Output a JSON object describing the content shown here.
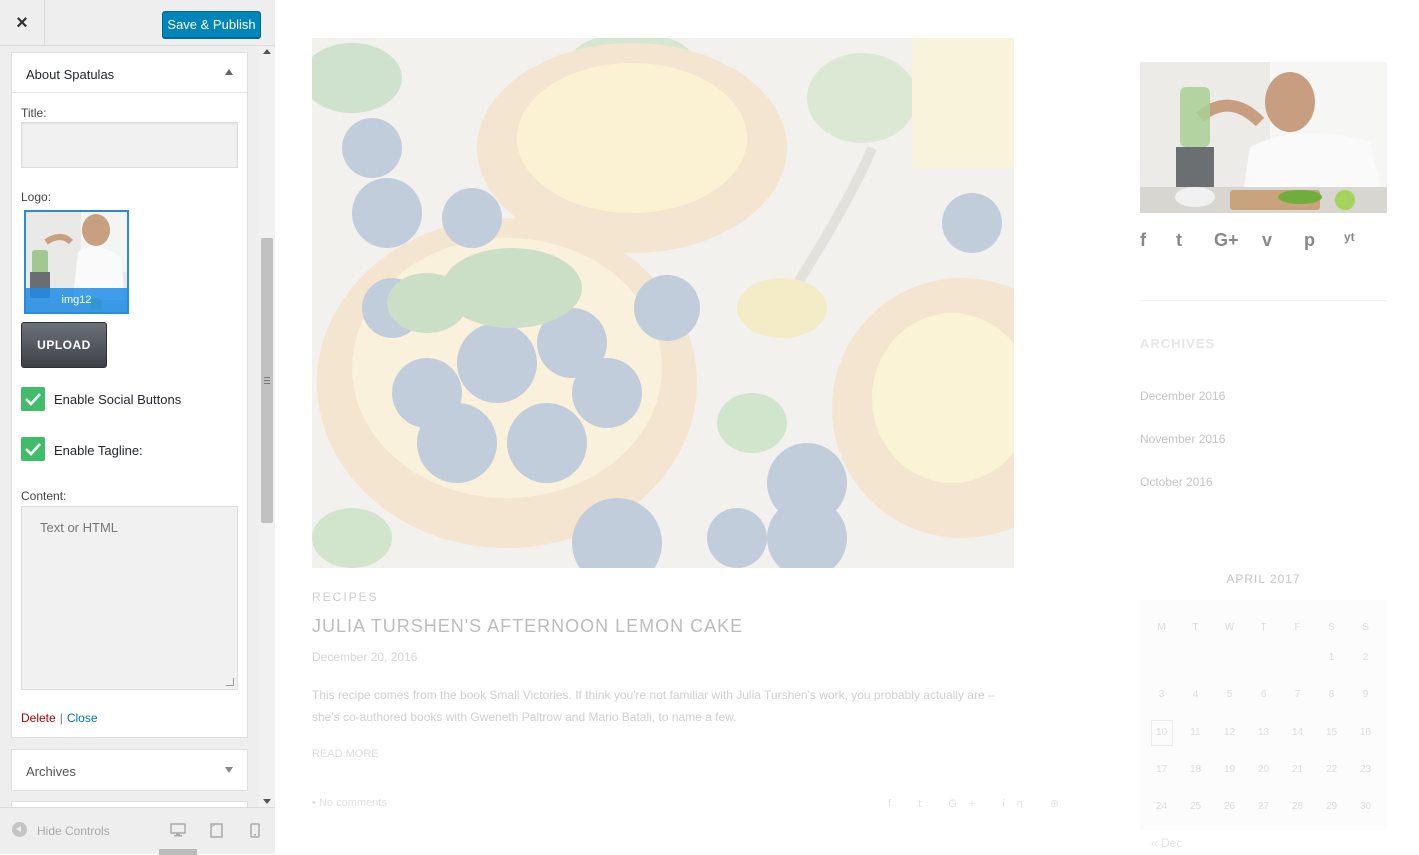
{
  "topbar": {
    "close_symbol": "×",
    "publish_label": "Save & Publish"
  },
  "widget": {
    "title": "About Spatulas",
    "title_label": "Title:",
    "title_value": "",
    "logo_label": "Logo:",
    "logo_caption": "img12",
    "upload_label": "UPLOAD",
    "social_label": "Enable Social Buttons",
    "social_checked": true,
    "tagline_label": "Enable Tagline:",
    "tagline_checked": true,
    "content_label": "Content:",
    "content_placeholder": "Text or HTML",
    "delete_label": "Delete",
    "separator": "|",
    "close_label": "Close"
  },
  "archives_widget": {
    "title": "Archives"
  },
  "footer": {
    "hide_controls_label": "Hide Controls",
    "devices": [
      "desktop-icon",
      "tablet-icon",
      "mobile-icon"
    ]
  },
  "preview": {
    "post": {
      "category": "RECIPES",
      "title": "JULIA TURSHEN'S AFTERNOON LEMON CAKE",
      "date": "December 20, 2016",
      "excerpt": "This recipe comes from the book Small Victories. If think you're not familiar with Julia Turshen's work, you probably actually are – she's co-authored books with Gweneth Paltrow and Mario Batali, to name a few.",
      "read_more": "READ MORE",
      "comments": "No comments",
      "share": "f  t  G+  in  ⊕"
    },
    "sidebar": {
      "social": [
        "f",
        "t",
        "G+",
        "v",
        "p",
        "yt"
      ],
      "archives_heading": "ARCHIVES",
      "archives": [
        "December 2016",
        "November 2016",
        "October 2016"
      ],
      "calendar": {
        "title": "APRIL 2017",
        "days": [
          "M",
          "T",
          "W",
          "T",
          "F",
          "S",
          "S"
        ],
        "rows": [
          [
            "",
            "",
            "",
            "",
            "",
            "1",
            "2"
          ],
          [
            "3",
            "4",
            "5",
            "6",
            "7",
            "8",
            "9"
          ],
          [
            "10",
            "11",
            "12",
            "13",
            "14",
            "15",
            "16"
          ],
          [
            "17",
            "18",
            "19",
            "20",
            "21",
            "22",
            "23"
          ],
          [
            "24",
            "25",
            "26",
            "27",
            "28",
            "29",
            "30"
          ]
        ],
        "prev": "« Dec"
      }
    }
  }
}
